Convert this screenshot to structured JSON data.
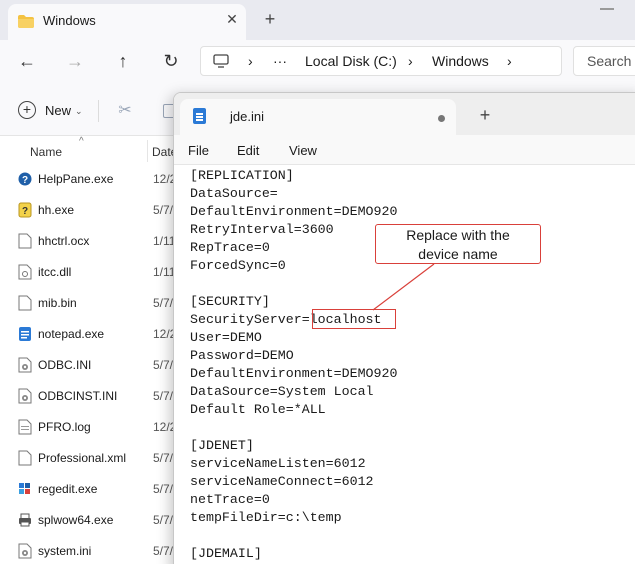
{
  "colors": {
    "annotation_red": "#d9403a",
    "notepad_icon_blue": "#2b7ad6",
    "folder_yellow": "#f4c242"
  },
  "explorer": {
    "tab": {
      "title": "Windows",
      "icon": "folder-icon",
      "close_glyph": "✕"
    },
    "new_tab_glyph": "+",
    "nav": {
      "back_glyph": "←",
      "forward_glyph": "→",
      "up_glyph": "↑",
      "refresh_glyph": "↻",
      "more_glyph": "···",
      "separator": "›"
    },
    "address": {
      "icon": "pc-icon",
      "crumbs": [
        "Local Disk (C:)",
        "Windows"
      ]
    },
    "search_placeholder": "Search W",
    "command_bar": {
      "new_label": "New",
      "caret": "⌄",
      "cut_icon": "scissors-icon",
      "copy_icon": "copy-icon"
    },
    "list": {
      "name_header": "Name",
      "date_header": "Date",
      "sort_glyph": "^",
      "rows": [
        {
          "name": "HelpPane.exe",
          "date": "12/2",
          "icon": "help-icon"
        },
        {
          "name": "hh.exe",
          "date": "5/7/",
          "icon": "help-doc-icon"
        },
        {
          "name": "hhctrl.ocx",
          "date": "1/11",
          "icon": "file-icon"
        },
        {
          "name": "itcc.dll",
          "date": "1/11",
          "icon": "dll-icon"
        },
        {
          "name": "mib.bin",
          "date": "5/7/",
          "icon": "file-icon"
        },
        {
          "name": "notepad.exe",
          "date": "12/2",
          "icon": "notepad-icon"
        },
        {
          "name": "ODBC.INI",
          "date": "5/7/",
          "icon": "ini-icon"
        },
        {
          "name": "ODBCINST.INI",
          "date": "5/7/",
          "icon": "ini-icon"
        },
        {
          "name": "PFRO.log",
          "date": "12/2",
          "icon": "log-icon"
        },
        {
          "name": "Professional.xml",
          "date": "5/7/",
          "icon": "file-icon"
        },
        {
          "name": "regedit.exe",
          "date": "5/7/",
          "icon": "regedit-icon"
        },
        {
          "name": "splwow64.exe",
          "date": "5/7/",
          "icon": "printer-icon"
        },
        {
          "name": "system.ini",
          "date": "5/7/",
          "icon": "ini-icon"
        }
      ]
    }
  },
  "notepad": {
    "tab_title": "jde.ini",
    "icon": "notepad-icon",
    "new_tab_glyph": "+",
    "menu": [
      "File",
      "Edit",
      "View"
    ],
    "lines": [
      "[REPLICATION]",
      "DataSource=",
      "DefaultEnvironment=DEMO920",
      "RetryInterval=3600",
      "RepTrace=0",
      "ForcedSync=0",
      "",
      "[SECURITY]",
      {
        "prefix": "SecurityServer=",
        "value": "localhost"
      },
      "User=DEMO",
      "Password=DEMO",
      "DefaultEnvironment=DEMO920",
      "DataSource=System Local",
      "Default Role=*ALL",
      "",
      "[JDENET]",
      "serviceNameListen=6012",
      "serviceNameConnect=6012",
      "netTrace=0",
      "tempFileDir=c:\\temp",
      "",
      "[JDEMAIL]"
    ]
  },
  "callout": {
    "line1": "Replace with the",
    "line2": "device name"
  }
}
